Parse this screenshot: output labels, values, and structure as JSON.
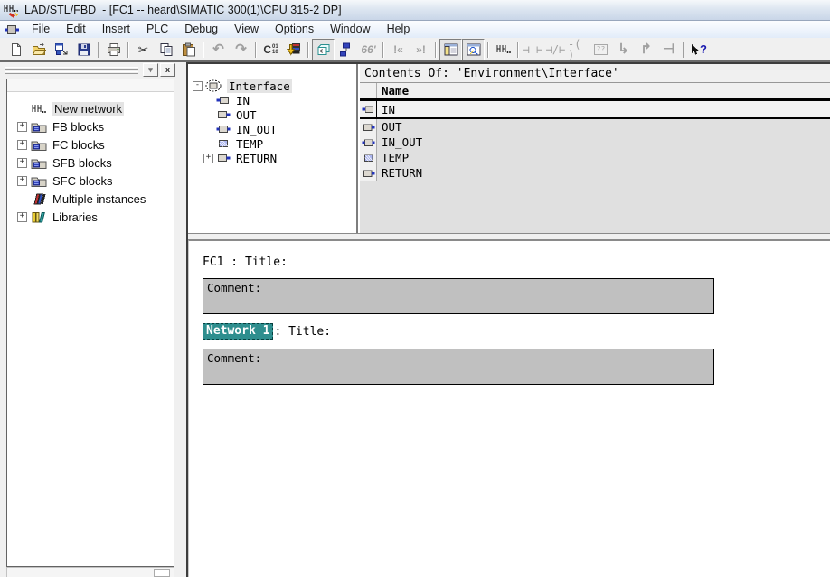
{
  "window": {
    "title": "LAD/STL/FBD  - [FC1 -- heard\\SIMATIC 300(1)\\CPU 315-2 DP]"
  },
  "menu": {
    "items": [
      "File",
      "Edit",
      "Insert",
      "PLC",
      "Debug",
      "View",
      "Options",
      "Window",
      "Help"
    ]
  },
  "icons": {
    "plus": "+",
    "minus": "-",
    "dropdown": "▾",
    "close": "x",
    "cut": "✂",
    "undo": "↶",
    "redo": "↷",
    "c_main": "C",
    "c_sup": "01",
    "c_sub": "10",
    "monitor": "66'",
    "prev_error": "!«",
    "next_error": "»!",
    "contact_no": "⊣ ⊢",
    "contact_nc": "⊣/⊢",
    "coil": "-( )",
    "empty_box": "??",
    "open_branch": "↳",
    "close_branch": "↱",
    "branch_end": "⊣",
    "help": "?"
  },
  "sidebar": {
    "items": [
      {
        "label": "New network"
      },
      {
        "label": "FB blocks"
      },
      {
        "label": "FC blocks"
      },
      {
        "label": "SFB blocks"
      },
      {
        "label": "SFC blocks"
      },
      {
        "label": "Multiple instances"
      },
      {
        "label": "Libraries"
      }
    ]
  },
  "interface_tree": {
    "root": "Interface",
    "items": [
      "IN",
      "OUT",
      "IN_OUT",
      "TEMP",
      "RETURN"
    ]
  },
  "contents": {
    "header": "Contents Of: 'Environment\\Interface'",
    "name_column": "Name",
    "rows": [
      "IN",
      "OUT",
      "IN_OUT",
      "TEMP",
      "RETURN"
    ]
  },
  "editor": {
    "block_header": "FC1 : Title:",
    "comment1": "Comment:",
    "network_badge": "Network 1",
    "network_suffix": ": Title:",
    "comment2": "Comment:"
  },
  "colors": {
    "network_highlight": "#2e8e8e",
    "comment_bg": "#c0c0c0",
    "titlebar_gradient_top": "#f5f8fb",
    "titlebar_gradient_bottom": "#c9d6e8"
  }
}
